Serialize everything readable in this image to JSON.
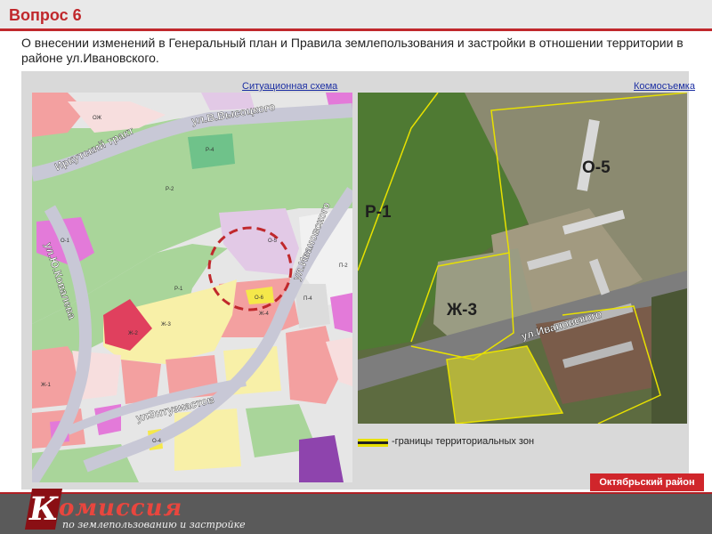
{
  "header": {
    "title": "Вопрос 6"
  },
  "subtitle": "О внесении изменений в Генеральный план и Правила землепользования и застройки в отношении территории в районе ул.Ивановского.",
  "left_panel": {
    "label": "Ситуационная схема",
    "streets": {
      "irkutsky": "Иркутский тракт",
      "vysotskogo": "ул.В.Высоцкого",
      "ivanovskogo": "ул.Ивановского",
      "kovaleva": "ул.Ю.Ковалева",
      "entuziastov": "улЭнтузиастов"
    },
    "zones": {
      "r1": "Р-1",
      "r2": "Р-2",
      "r4": "Р-4",
      "o1": "О-1",
      "o4": "О-4",
      "o5": "О-5",
      "o6": "О-6",
      "ozh": "ОЖ",
      "zh1": "Ж-1",
      "zh2": "Ж-2",
      "zh3": "Ж-3",
      "zh4": "Ж-4",
      "p4": "П-4",
      "p2": "П-2"
    }
  },
  "right_panel": {
    "label": "Космосъемка",
    "zones": {
      "r1": "Р-1",
      "o5": "О-5",
      "zh3": "Ж-3"
    },
    "street": "ул.Ивановского"
  },
  "legend": {
    "text": "-границы территориальных зон"
  },
  "district": "Октябрьский район",
  "footer": {
    "logo_letter": "К",
    "logo_main": "омиссия",
    "logo_sub": "по землепользованию и застройке"
  },
  "colors": {
    "accent_red": "#c0282c",
    "link_blue": "#1c2fa3",
    "zone_green": "#a9d59a",
    "zone_pink": "#f3a0a0",
    "zone_yellow": "#f8f0a8",
    "zone_lilac": "#e2c9e6",
    "zone_magenta": "#e37ad9",
    "boundary_yellow": "#e8e100"
  }
}
